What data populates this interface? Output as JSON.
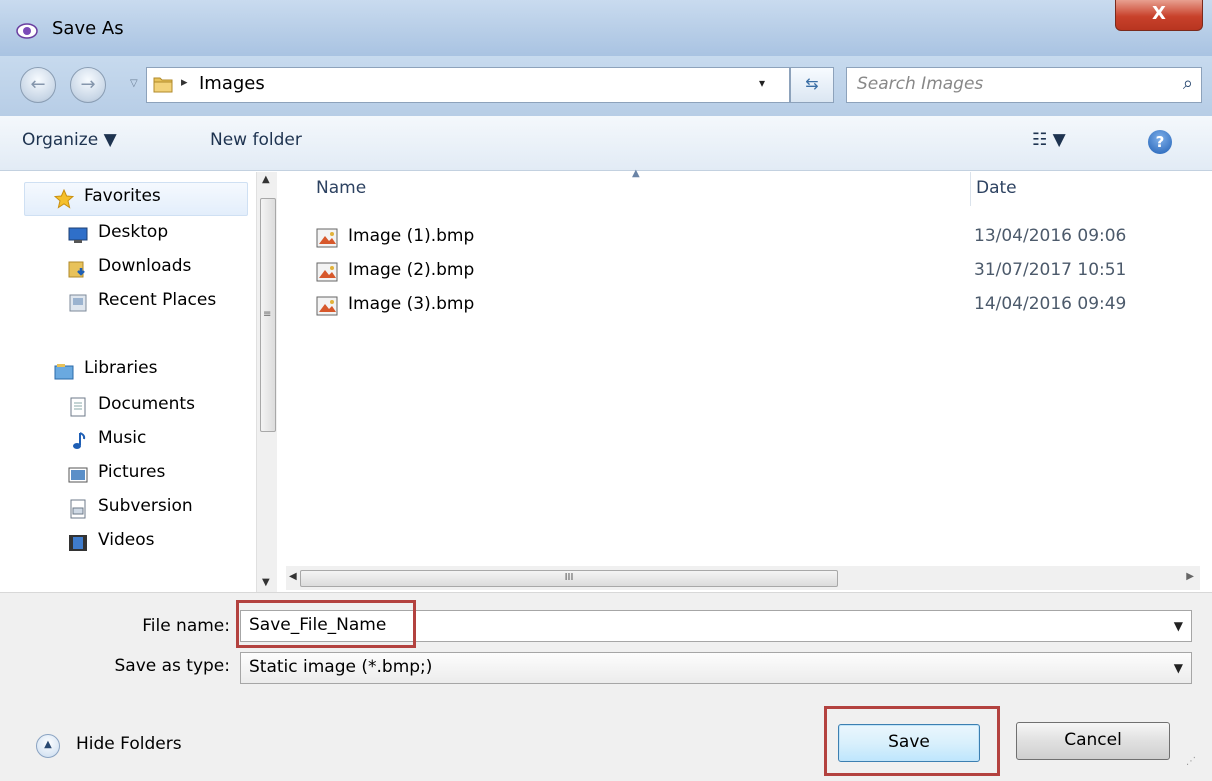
{
  "window": {
    "title": "Save As",
    "close_glyph": "X"
  },
  "nav": {
    "back_glyph": "←",
    "forward_glyph": "→",
    "history_dropdown": "▽",
    "breadcrumb_separator": "▸",
    "breadcrumb": "Images",
    "address_dropdown": "▾",
    "refresh_glyph": "⇆",
    "search_placeholder": "Search Images",
    "search_glyph": "⌕"
  },
  "toolbar": {
    "organize_label": "Organize ▼",
    "new_folder_label": "New folder",
    "view_glyph": "☷ ▼",
    "help_glyph": "?"
  },
  "sidebar": {
    "favorites_label": "Favorites",
    "favorites_items": [
      "Desktop",
      "Downloads",
      "Recent Places"
    ],
    "libraries_label": "Libraries",
    "libraries_items": [
      "Documents",
      "Music",
      "Pictures",
      "Subversion",
      "Videos"
    ]
  },
  "columns": {
    "name": "Name",
    "date": "Date"
  },
  "files": [
    {
      "name": "Image (1).bmp",
      "date": "13/04/2016 09:06"
    },
    {
      "name": "Image (2).bmp",
      "date": "31/07/2017 10:51"
    },
    {
      "name": "Image (3).bmp",
      "date": "14/04/2016 09:49"
    }
  ],
  "scrollbars": {
    "up": "▲",
    "down": "▼",
    "left": "◀",
    "right": "▶",
    "thumb_grip": "III",
    "v_grip": "≡"
  },
  "form": {
    "file_name_label": "File name:",
    "file_name_value": "Save_File_Name",
    "save_type_label": "Save as type:",
    "save_type_value": "Static image (*.bmp;)",
    "dropdown_glyph": "▼"
  },
  "footer": {
    "hide_folders_label": "Hide Folders",
    "hide_folders_glyph": "▲",
    "save_label": "Save",
    "cancel_label": "Cancel",
    "resize_grip": "⋰"
  },
  "colors": {
    "highlight_box": "#b3423f",
    "title_gradient": "#b9cfe8",
    "close_button": "#c8412b",
    "accent": "#1f5fb5"
  }
}
